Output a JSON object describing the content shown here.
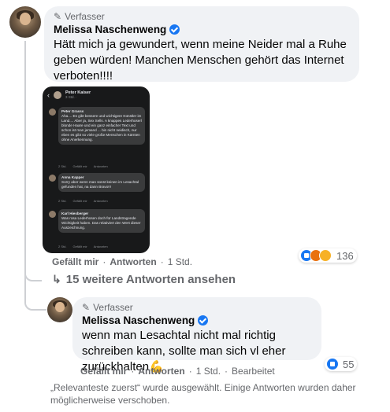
{
  "comment1": {
    "author_tag": "Verfasser",
    "author_name": "Melissa Naschenweng",
    "text": "Hätt mich ja gewundert, wenn meine Neider mal a Ruhe geben würden! Manchen Menschen gehört das Internet verboten!!!!",
    "actions": {
      "like": "Gefällt mir",
      "reply": "Antworten",
      "time": "1 Std."
    },
    "reaction_count": "136",
    "reaction_icons": [
      "like-reaction-icon",
      "angry-reaction-icon",
      "sad-reaction-icon"
    ]
  },
  "screenshot": {
    "header_name": "Peter Kaiser",
    "header_sub": "3 Std. · ",
    "items": [
      {
        "name": "Peter Grasss",
        "text": "Aha.... Es gibt bessere und wichtigere Künstler im Land.... Aber ja, Sex Sells. A knappes Lederhoserl blonde Haare und ein ganz einfacher Text und schon ist man jemand ... bin nicht neidisch, nur eben es gibt so viele große Menschen in Kärnten ohne Anerkennung.",
        "time": "2 Std.",
        "like": "Gefällt mir",
        "reply": "Antworten"
      },
      {
        "name": "Anna Kapper",
        "text": "Sorry aber wenn man sonst keinen im Lesachtal gefunden hat, na dann Bravo!!!",
        "time": "2 Std.",
        "like": "Gefällt mir",
        "reply": "Antworten"
      },
      {
        "name": "Karl Hiesberger",
        "text": "Was rosa Lederhosen doch für Landstragende Wichtigkeit haben. Das relativiert den Wert dieser Auszeichnung.",
        "time": "2 Std.",
        "like": "Gefällt mir",
        "reply": "Antworten"
      }
    ]
  },
  "more_replies": "15 weitere Antworten ansehen",
  "comment2": {
    "author_tag": "Verfasser",
    "author_name": "Melissa Naschenweng",
    "text": "wenn man Lesachtal nicht mal richtig schreiben kann, sollte man sich vl eher zurückhalten",
    "emoji": "💪",
    "actions": {
      "like": "Gefällt mir",
      "reply": "Antworten",
      "time": "1 Std.",
      "edited": "Bearbeitet"
    },
    "reaction_count": "55"
  },
  "footnote": "„Relevanteste zuerst“ wurde ausgewählt. Einige Antworten wurden daher möglicherweise verschoben."
}
